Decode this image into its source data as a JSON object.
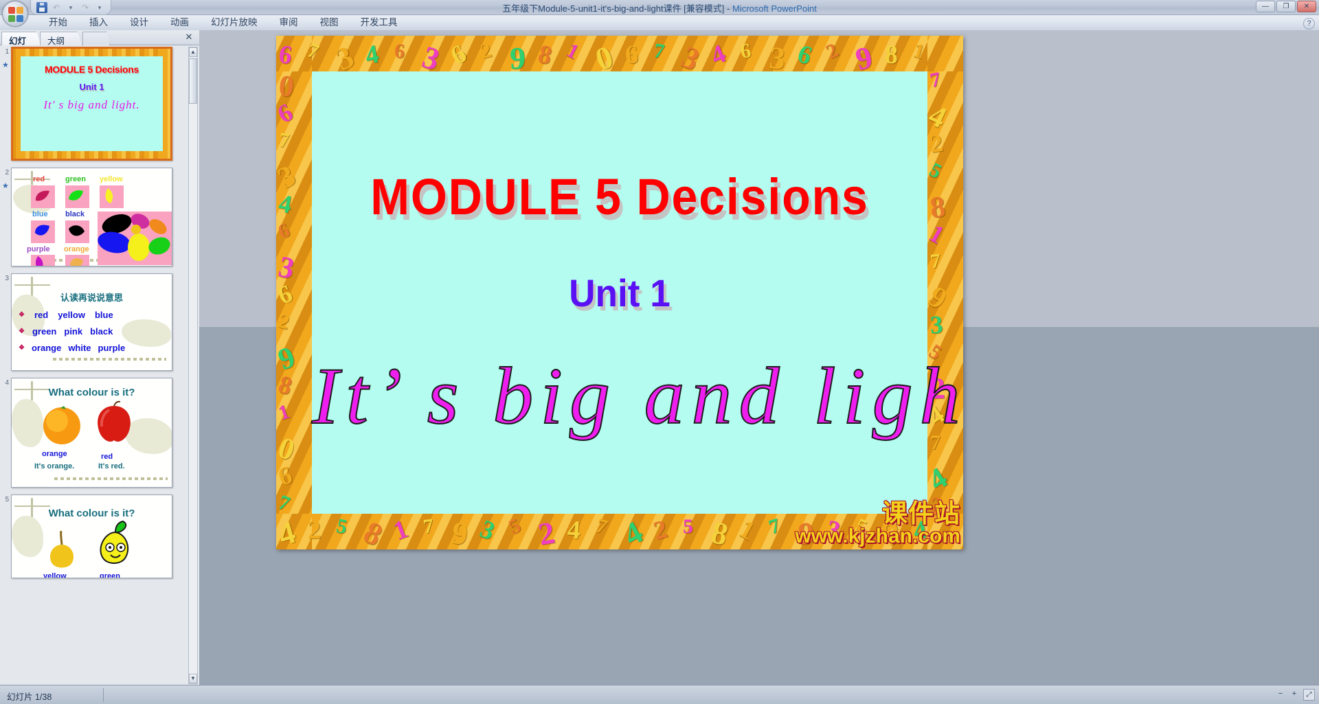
{
  "window": {
    "title_doc": "五年级下Module-5-unit1-it's-big-and-light课件 [兼容模式]",
    "title_sep": " - ",
    "title_app": "Microsoft PowerPoint",
    "minimize": "—",
    "restore": "❐",
    "close": "✕",
    "help": "?"
  },
  "quick_access": {
    "save_icon": "save-icon",
    "undo_icon": "↶",
    "undo_arrow": "▾",
    "redo_icon": "↷",
    "customize_icon": "▾"
  },
  "ribbon_tabs": [
    {
      "label": "开始"
    },
    {
      "label": "插入"
    },
    {
      "label": "设计"
    },
    {
      "label": "动画"
    },
    {
      "label": "幻灯片放映"
    },
    {
      "label": "审阅"
    },
    {
      "label": "视图"
    },
    {
      "label": "开发工具"
    }
  ],
  "left_pane": {
    "tabs": [
      {
        "label": "幻灯片",
        "selected": true
      },
      {
        "label": "大纲",
        "selected": false
      }
    ],
    "close_label": "✕",
    "scroll": {
      "up": "▲",
      "down": "▼"
    }
  },
  "slides": [
    {
      "number": "1",
      "line1": "MODULE 5  Decisions",
      "line2": "Unit 1",
      "line3": "It' s big and light."
    },
    {
      "number": "2",
      "colors": [
        {
          "word": "red",
          "hex": "#e8453c"
        },
        {
          "word": "green",
          "hex": "#2ec11f"
        },
        {
          "word": "yellow",
          "hex": "#f2e62b"
        },
        {
          "word": "blue",
          "hex": "#3f8fe0"
        },
        {
          "word": "black",
          "hex": "#2b34c4"
        },
        {
          "word": "purple",
          "hex": "#9b4bc4"
        },
        {
          "word": "orange",
          "hex": "#efa733"
        }
      ]
    },
    {
      "number": "3",
      "heading": "认读再说说意思",
      "rows": [
        [
          "red",
          "yellow",
          "blue"
        ],
        [
          "green",
          "pink",
          "black"
        ],
        [
          "orange",
          "white",
          "purple"
        ]
      ],
      "bullet": "❖"
    },
    {
      "number": "4",
      "heading": "What colour is it?",
      "items": [
        {
          "word": "orange",
          "sentence": "It's orange."
        },
        {
          "word": "red",
          "sentence": "It's red."
        }
      ]
    },
    {
      "number": "5",
      "heading": "What colour is it?",
      "items": [
        {
          "word": "yellow"
        },
        {
          "word": "green"
        }
      ]
    }
  ],
  "main_slide": {
    "title": "MODULE  5    Decisions",
    "unit": "Unit 1",
    "sentence": "It’ s  big  and  light.",
    "bg_color": "#b3fcef",
    "title_color": "#fe0000",
    "unit_color": "#5a10f3",
    "sentence_color": "#ee1fee",
    "border_numbers": [
      "6",
      "4",
      "7",
      "2",
      "3",
      "5",
      "4",
      "8",
      "6",
      "1",
      "3",
      "7",
      "6",
      "9",
      "2",
      "3",
      "9",
      "5",
      "8",
      "2",
      "1",
      "4",
      "0",
      "7"
    ]
  },
  "watermark": {
    "line1": "课件站",
    "line2": "www.kjzhan.com"
  },
  "status_bar": {
    "slide_count": "幻灯片 1/38",
    "zoom_out": "−",
    "zoom_in": "+",
    "fit": "⤢"
  }
}
